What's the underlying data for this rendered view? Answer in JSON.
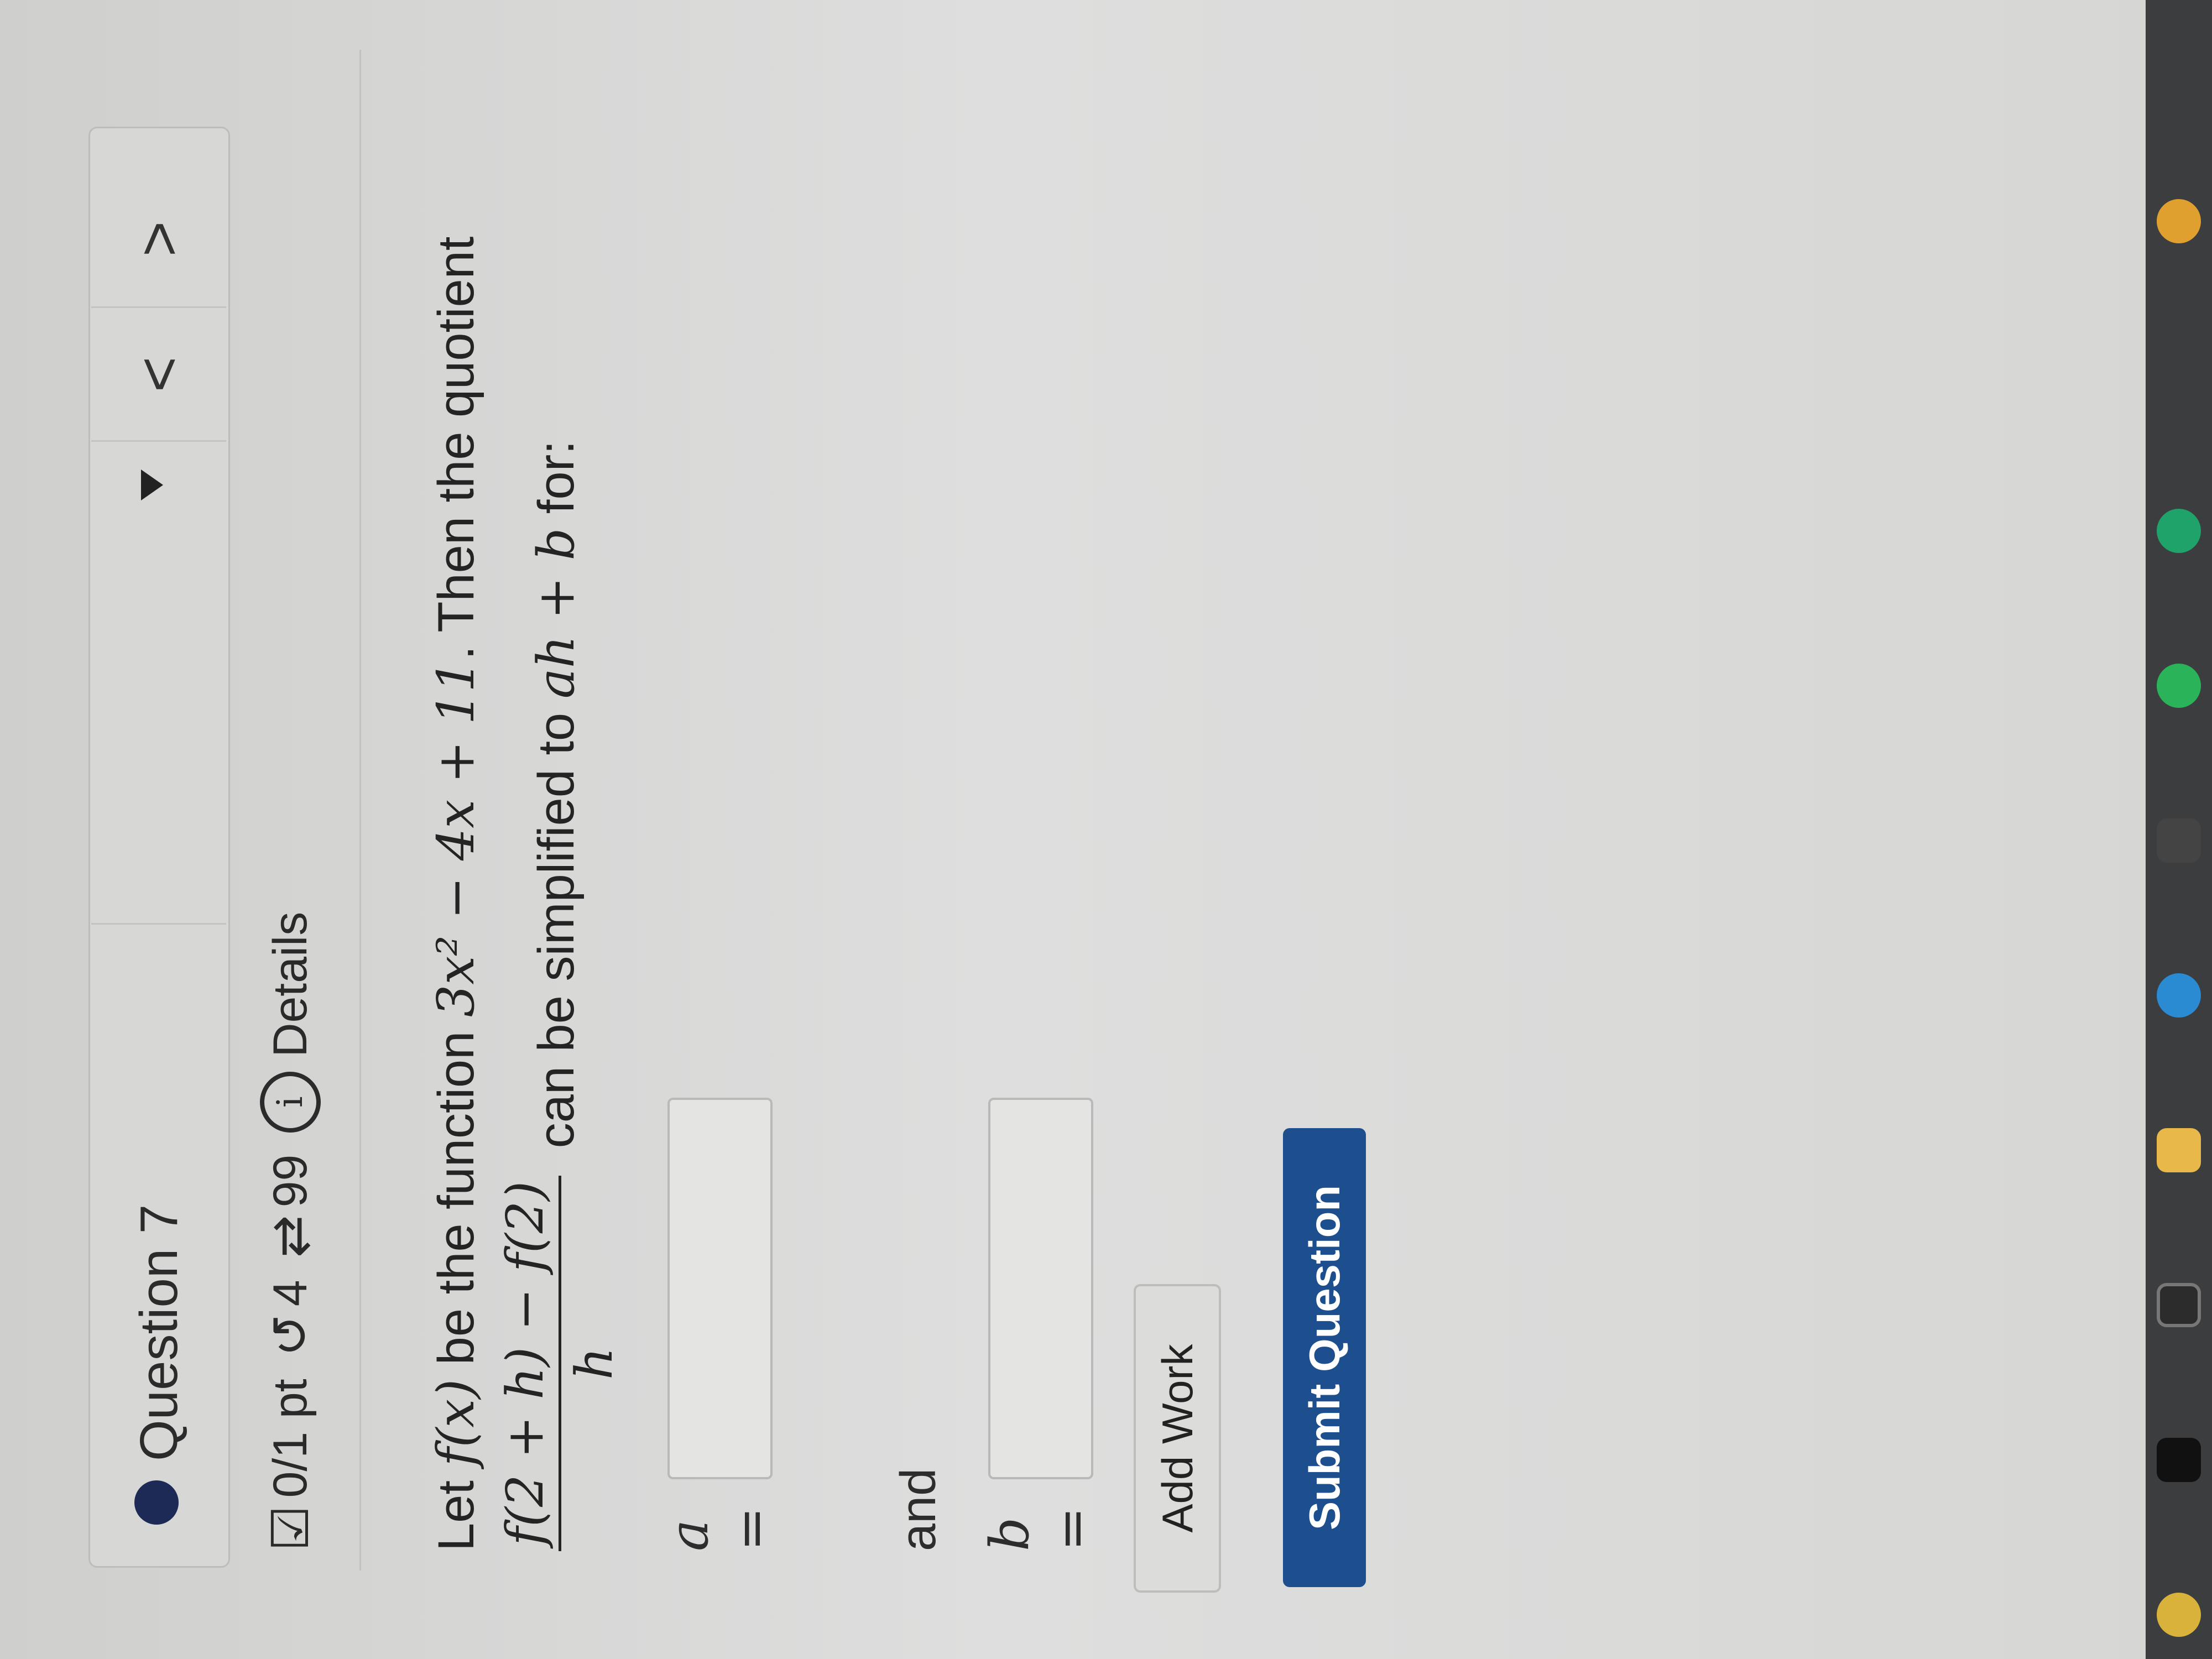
{
  "header": {
    "question_title": "Question 7",
    "question_selector_value": "",
    "prev_label": "<",
    "next_label": ">"
  },
  "meta": {
    "score": "0/1 pt",
    "attempts": "4",
    "retries": "99",
    "details_label": "Details"
  },
  "problem": {
    "intro": "Let",
    "fx": "f(x)",
    "be_the_function": "be the function",
    "function_expr": "3x² − 4x + 11",
    "then_quotient": ". Then the quotient",
    "frac_num": "f(2 + h) − f(2)",
    "frac_den": "h",
    "simplified_text": "can be simplified to",
    "form": "ah + b",
    "for_text": "for:"
  },
  "answers": {
    "a_label": "a =",
    "a_value": "",
    "and_text": "and",
    "b_label": "b =",
    "b_value": ""
  },
  "actions": {
    "add_work_label": "Add Work",
    "submit_label": "Submit Question"
  },
  "colors": {
    "accent": "#1d4f8f",
    "dot": "#1c2a55"
  },
  "taskbar_icons": [
    "audible-icon",
    "app-icon",
    "camera-icon",
    "files-icon",
    "browser-icon",
    "store-icon",
    "spotify-icon",
    "edge-icon",
    "chrome-icon"
  ]
}
